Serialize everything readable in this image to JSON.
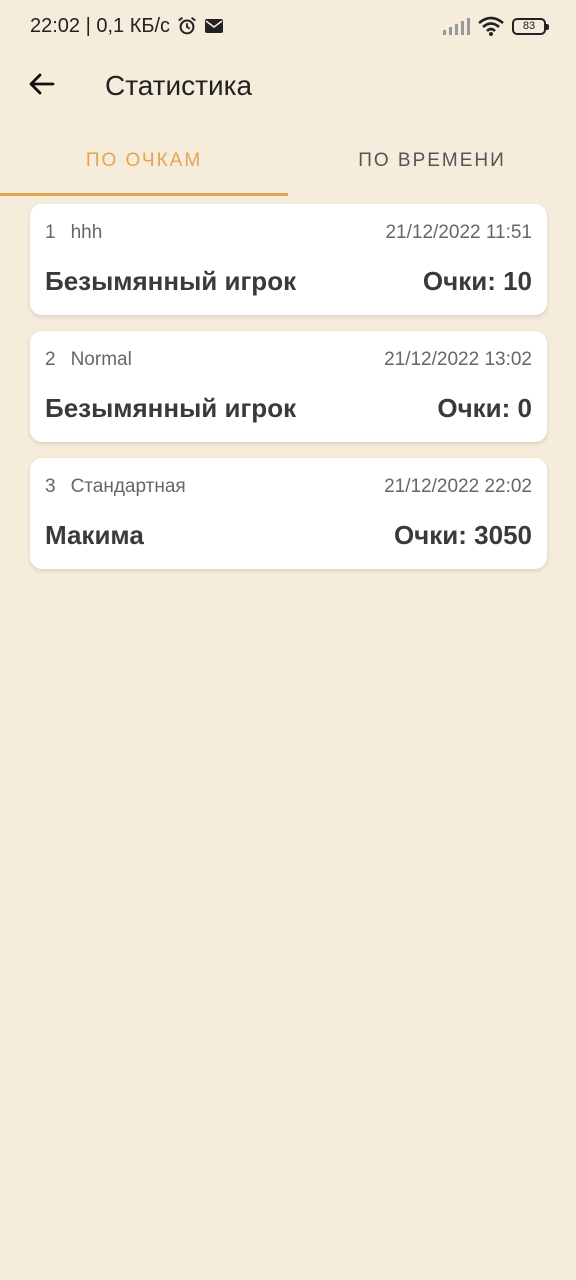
{
  "status_bar": {
    "time_speed": "22:02 | 0,1 КБ/с",
    "battery": "83",
    "icons": [
      "alarm-icon",
      "mail-icon",
      "signal-icon",
      "wifi-icon",
      "battery-icon"
    ]
  },
  "header": {
    "title": "Статистика"
  },
  "tabs": [
    {
      "label": "ПО ОЧКАМ",
      "active": true
    },
    {
      "label": "ПО ВРЕМЕНИ",
      "active": false
    }
  ],
  "records": [
    {
      "rank": "1",
      "mode": "hhh",
      "date": "21/12/2022 11:51",
      "player": "Безымянный игрок",
      "score": "Очки: 10"
    },
    {
      "rank": "2",
      "mode": "Normal",
      "date": "21/12/2022 13:02",
      "player": "Безымянный игрок",
      "score": "Очки: 0"
    },
    {
      "rank": "3",
      "mode": "Стандартная",
      "date": "21/12/2022 22:02",
      "player": "Макима",
      "score": "Очки: 3050"
    }
  ],
  "colors": {
    "background": "#f5ecdb",
    "accent": "#e5a54e",
    "card": "#ffffff"
  }
}
